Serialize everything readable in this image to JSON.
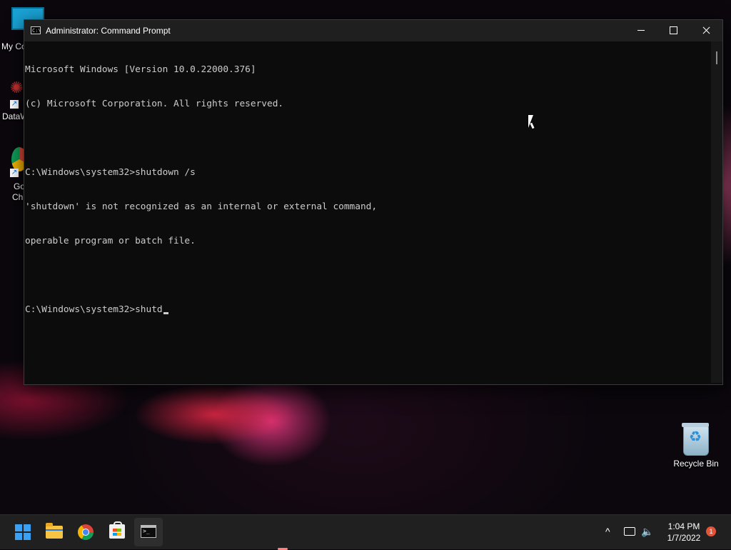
{
  "desktop": {
    "icons": {
      "my_computer": "My Co",
      "datawrapper": "DataW",
      "chrome_line1": "Go",
      "chrome_line2": "Chr",
      "recycle_bin": "Recycle Bin"
    }
  },
  "window": {
    "title": "Administrator: Command Prompt",
    "console_lines": [
      "Microsoft Windows [Version 10.0.22000.376]",
      "(c) Microsoft Corporation. All rights reserved.",
      "",
      "C:\\Windows\\system32>shutdown /s",
      "'shutdown' is not recognized as an internal or external command,",
      "operable program or batch file.",
      "",
      "C:\\Windows\\system32>shutd"
    ],
    "buttons": {
      "minimize": "minimize",
      "maximize": "maximize",
      "close": "close"
    }
  },
  "taskbar": {
    "apps": [
      "start",
      "file-explorer",
      "chrome",
      "microsoft-store",
      "command-prompt"
    ],
    "clock": {
      "time": "1:04 PM",
      "date": "1/7/2022"
    },
    "notification_count": "1",
    "tray_chevron": "^",
    "volume_glyph": "🔈"
  },
  "colors": {
    "console_bg": "#0c0c0c",
    "console_text": "#cccccc",
    "taskbar_bg": "#202020",
    "notification": "#e2533a"
  }
}
